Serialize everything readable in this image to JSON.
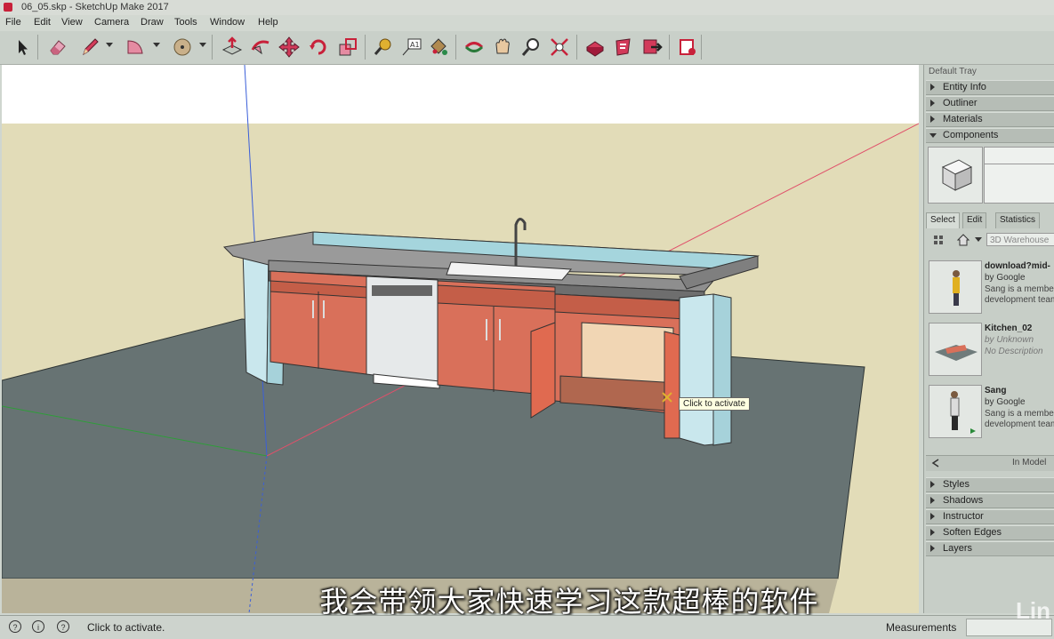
{
  "window": {
    "title": "06_05.skp - SketchUp Make 2017"
  },
  "menu": [
    "File",
    "Edit",
    "View",
    "Camera",
    "Draw",
    "Tools",
    "Window",
    "Help"
  ],
  "toolbar": {
    "tools": [
      "select-tool",
      "eraser-tool",
      "pencil-tool",
      "arc-tool",
      "shape-tool",
      "push-pull-tool",
      "follow-me-tool",
      "move-tool",
      "rotate-tool",
      "scale-tool",
      "tape-measure-tool",
      "text-tool",
      "paint-bucket-tool",
      "orbit-tool",
      "pan-tool",
      "zoom-tool",
      "zoom-extents-tool",
      "warehouse-tool",
      "extension-warehouse-tool",
      "share-model-tool",
      "extension-manager-tool"
    ]
  },
  "viewport": {
    "tooltip": "Click to activate",
    "subtitle": "我会带领大家快速学习这款超棒的软件"
  },
  "tray": {
    "title": "Default Tray",
    "sections_top": [
      {
        "label": "Entity Info",
        "open": false
      },
      {
        "label": "Outliner",
        "open": false
      },
      {
        "label": "Materials",
        "open": false
      },
      {
        "label": "Components",
        "open": true
      }
    ],
    "tabs": [
      "Select",
      "Edit",
      "Statistics"
    ],
    "search_placeholder": "3D Warehouse",
    "components": [
      {
        "title": "download?mid-",
        "by": "by Google",
        "desc1": "Sang is a member",
        "desc2": "development team"
      },
      {
        "title": "Kitchen_02",
        "by": "by Unknown",
        "desc1": "No Description",
        "desc2": ""
      },
      {
        "title": "Sang",
        "by": "by Google",
        "desc1": "Sang is a member",
        "desc2": "development team"
      }
    ],
    "in_model_label": "In Model",
    "sections_bottom": [
      {
        "label": "Styles"
      },
      {
        "label": "Shadows"
      },
      {
        "label": "Instructor"
      },
      {
        "label": "Soften Edges"
      },
      {
        "label": "Layers"
      }
    ]
  },
  "statusbar": {
    "hint": "Click to activate.",
    "measurements_label": "Measurements",
    "watermark": "Lin"
  },
  "colors": {
    "sky": "#ffffff",
    "ground": "#e2dcb8",
    "floor_slab": "#677373",
    "cabinet": "#d9705a",
    "countertop": "#8c8c8c",
    "end_panel": "#c8e6ec"
  }
}
